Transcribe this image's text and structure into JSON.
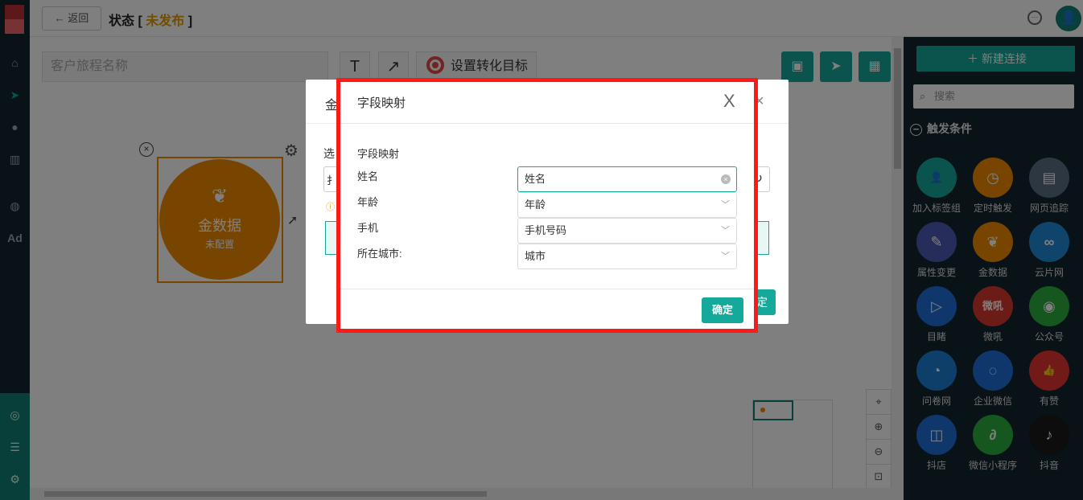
{
  "header": {
    "back_label": "返回",
    "status_label": "状态",
    "status_value": "未发布",
    "bracket_open": "[",
    "bracket_close": "]"
  },
  "canvas": {
    "journey_name_placeholder": "客户旅程名称",
    "text_tool_glyph": "T",
    "arrow_tool_glyph": "↗",
    "conversion_goal_label": "设置转化目标",
    "node": {
      "title": "金数据",
      "subtitle": "未配置"
    }
  },
  "right_panel": {
    "new_connection_label": "新建连接",
    "search_placeholder": "搜索",
    "section_title": "触发条件",
    "tiles": [
      {
        "label": "加入标签组",
        "color": "#15a99b",
        "icon": "user-plus-icon",
        "glyph": "👤"
      },
      {
        "label": "定时触发",
        "color": "#f08a00",
        "icon": "clock-icon",
        "glyph": "◷"
      },
      {
        "label": "网页追踪",
        "color": "#5b6f82",
        "icon": "webpage-icon",
        "glyph": "▤"
      },
      {
        "label": "属性变更",
        "color": "#4d5bb5",
        "icon": "edit-icon",
        "glyph": "✎"
      },
      {
        "label": "金数据",
        "color": "#f08a00",
        "icon": "sprout-icon",
        "glyph": "❦"
      },
      {
        "label": "云片网",
        "color": "#1f8ad6",
        "icon": "cloud-link-icon",
        "glyph": "∞"
      },
      {
        "label": "目睹",
        "color": "#1f6fd6",
        "icon": "play-icon",
        "glyph": "▷"
      },
      {
        "label": "微吼",
        "color": "#d9392e",
        "icon": "weihou-icon",
        "glyph": "微吼"
      },
      {
        "label": "公众号",
        "color": "#2aae3c",
        "icon": "wechat-icon",
        "glyph": "◉"
      },
      {
        "label": "问卷网",
        "color": "#1a7fd4",
        "icon": "survey-icon",
        "glyph": "◔"
      },
      {
        "label": "企业微信",
        "color": "#1f6fd6",
        "icon": "work-wechat-icon",
        "glyph": "◌"
      },
      {
        "label": "有赞",
        "color": "#e3342f",
        "icon": "youzan-icon",
        "glyph": "👍"
      },
      {
        "label": "抖店",
        "color": "#1f6fd6",
        "icon": "doudian-icon",
        "glyph": "◫"
      },
      {
        "label": "微信小程序",
        "color": "#2aae3c",
        "icon": "mini-program-icon",
        "glyph": "∂"
      },
      {
        "label": "抖音",
        "color": "#1a1a1a",
        "icon": "douyin-icon",
        "glyph": "♪"
      }
    ]
  },
  "back_dialog": {
    "title_fragment": "金",
    "label_fragment": "选",
    "input_fragment": "扌",
    "confirm_fragment": "定"
  },
  "dialog": {
    "title": "字段映射",
    "section_label": "字段映射",
    "rows": [
      {
        "label": "姓名",
        "value": "姓名"
      },
      {
        "label": "年龄",
        "value": "年龄"
      },
      {
        "label": "手机",
        "value": "手机号码"
      },
      {
        "label": "所在城市:",
        "value": "城市"
      }
    ],
    "confirm_label": "确定",
    "close_glyph": "X"
  }
}
